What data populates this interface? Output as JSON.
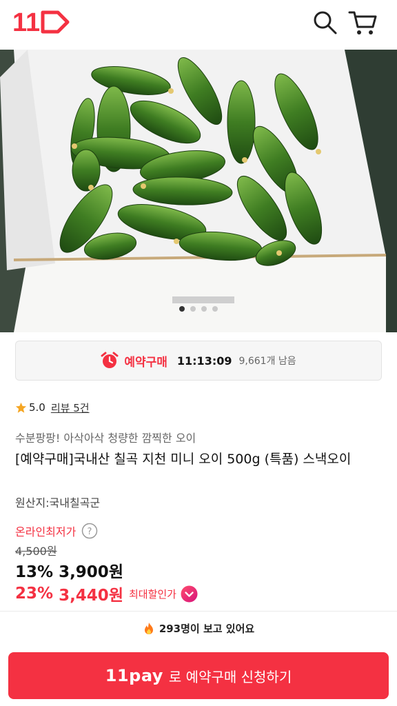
{
  "header": {
    "logo_text": "11",
    "icons": {
      "search": "search-icon",
      "cart": "cart-icon"
    },
    "brand_color": "#f43142"
  },
  "hero": {
    "image": "cucumbers-in-box",
    "carousel_total": 4,
    "carousel_active": 1
  },
  "reservation": {
    "label": "예약구매",
    "time": "11:13:09",
    "remaining": "9,661개 남음",
    "icon": "alarm-clock-icon"
  },
  "rating": {
    "score": "5.0",
    "review_link": "리뷰 5건",
    "icon": "star-icon"
  },
  "product": {
    "subtitle": "수분팡팡! 아삭아삭 청량한 깜찍한 오이",
    "title": "[예약구매]국내산 칠곡 지천 미니 오이 500g (특품) 스낵오이",
    "origin": "원산지:국내칠곡군"
  },
  "pricing": {
    "online_lowest_label": "온라인최저가",
    "original_price": "4,500원",
    "discount1_pct": "13%",
    "discount1_price": "3,900원",
    "discount2_pct": "23%",
    "discount2_price": "3,440원",
    "max_discount_label": "최대할인가",
    "accent_color": "#f43142"
  },
  "viewers": {
    "text": "293명이 보고 있어요",
    "icon": "fire-icon"
  },
  "cta": {
    "pay_label": "11pay",
    "action_label": "로 예약구매 신청하기"
  }
}
